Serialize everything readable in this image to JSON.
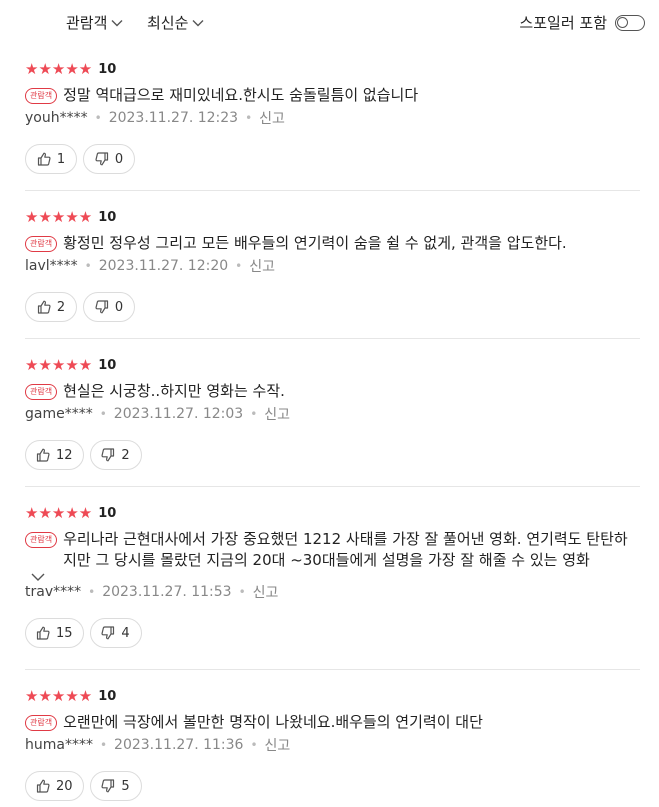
{
  "filters": {
    "audience_label": "관람객",
    "sort_label": "최신순",
    "spoiler_label": "스포일러 포함",
    "spoiler_enabled": false
  },
  "reviews": [
    {
      "stars": "★★★★★",
      "score": "10",
      "badge": "관람객",
      "text": "정말 역대급으로 재미있네요.한시도 숨돌릴틈이 없습니다",
      "user": "youh****",
      "date": "2023.11.27. 12:23",
      "report": "신고",
      "likes": "1",
      "dislikes": "0"
    },
    {
      "stars": "★★★★★",
      "score": "10",
      "badge": "관람객",
      "text": "황정민 정우성 그리고 모든 배우들의 연기력이 숨을 쉴 수 없게, 관객을 압도한다.",
      "user": "lavl****",
      "date": "2023.11.27. 12:20",
      "report": "신고",
      "likes": "2",
      "dislikes": "0"
    },
    {
      "stars": "★★★★★",
      "score": "10",
      "badge": "관람객",
      "text": "현실은 시궁창..하지만 영화는 수작.",
      "user": "game****",
      "date": "2023.11.27. 12:03",
      "report": "신고",
      "likes": "12",
      "dislikes": "2"
    },
    {
      "stars": "★★★★★",
      "score": "10",
      "badge": "관람객",
      "text": "우리나라 근현대사에서 가장 중요했던 1212 사태를 가장 잘 풀어낸 영화. 연기력도 탄탄하지만 그 당시를 몰랐던 지금의 20대 ~30대들에게 설명을 가장 잘 해줄 수 있는 영화",
      "user": "trav****",
      "date": "2023.11.27. 11:53",
      "report": "신고",
      "likes": "15",
      "dislikes": "4"
    },
    {
      "stars": "★★★★★",
      "score": "10",
      "badge": "관람객",
      "text": "오랜만에 극장에서 볼만한 명작이 나왔네요.배우들의 연기력이 대단",
      "user": "huma****",
      "date": "2023.11.27. 11:36",
      "report": "신고",
      "likes": "20",
      "dislikes": "5"
    }
  ]
}
